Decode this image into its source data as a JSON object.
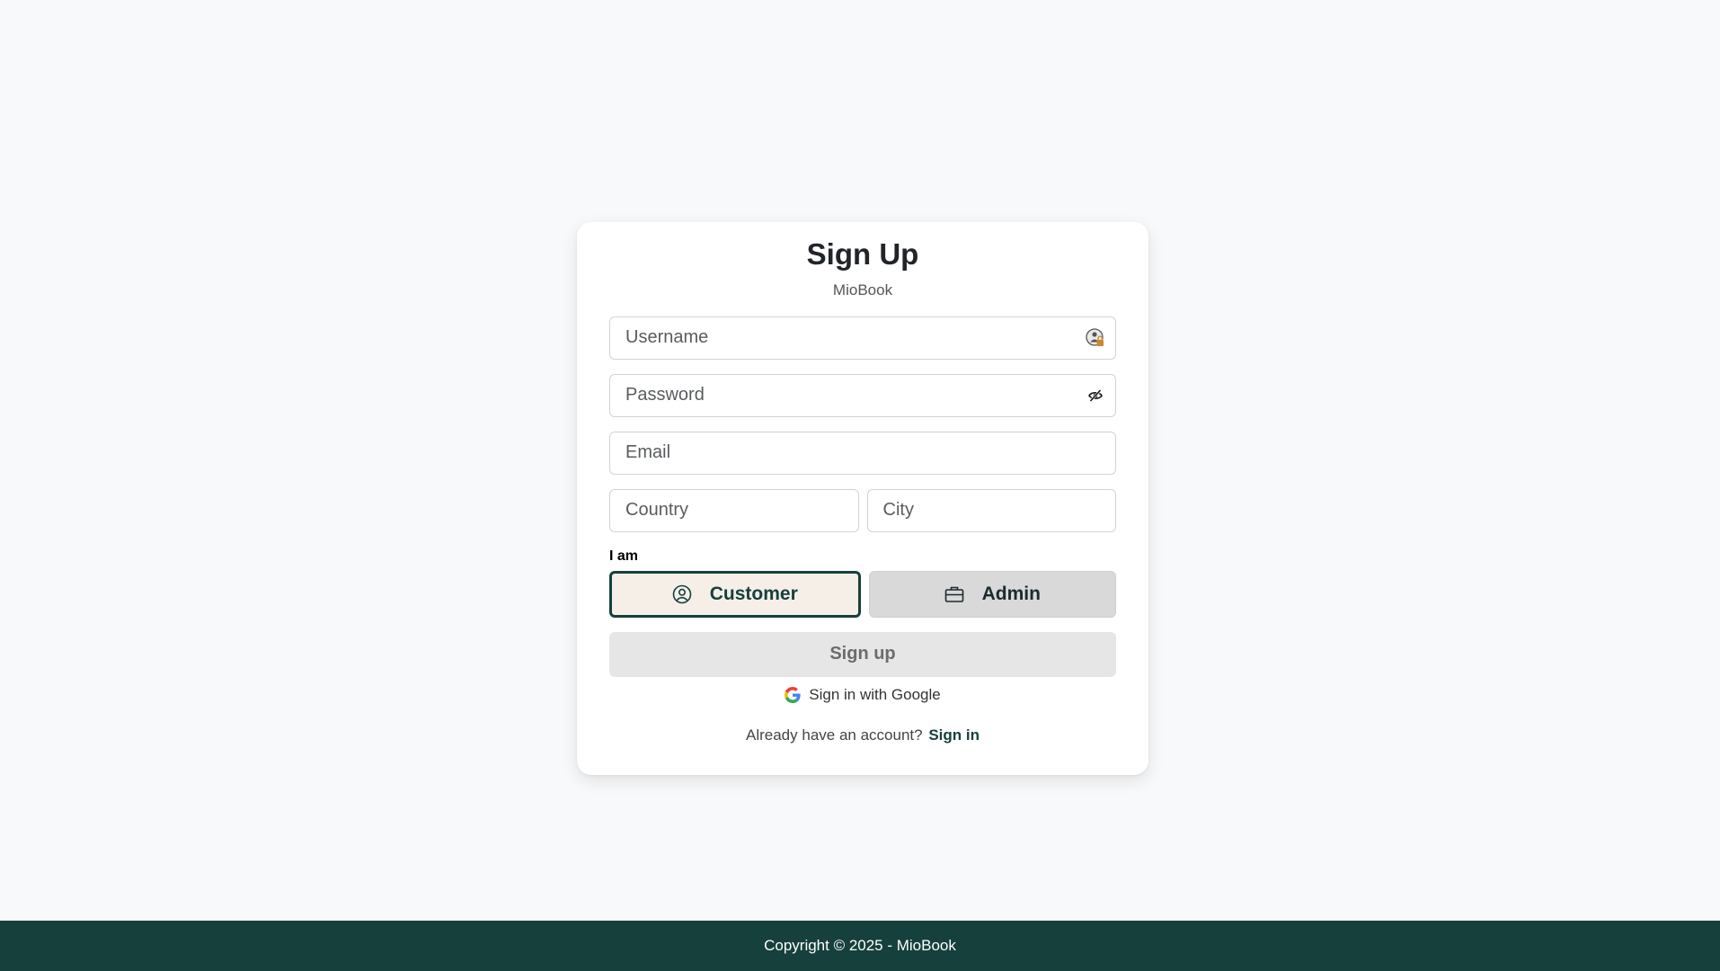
{
  "header": {
    "title": "Sign Up",
    "subtitle": "MioBook"
  },
  "form": {
    "username": {
      "placeholder": "Username",
      "value": "",
      "suffix_icon": "password-manager-icon"
    },
    "password": {
      "placeholder": "Password",
      "value": "",
      "suffix_icon": "eye-slash-icon"
    },
    "email": {
      "placeholder": "Email",
      "value": ""
    },
    "country": {
      "placeholder": "Country",
      "value": ""
    },
    "city": {
      "placeholder": "City",
      "value": ""
    }
  },
  "role": {
    "label": "I am",
    "selected": "Customer",
    "options": [
      {
        "label": "Customer",
        "icon": "user-circle-icon"
      },
      {
        "label": "Admin",
        "icon": "briefcase-icon"
      }
    ]
  },
  "actions": {
    "submit_label": "Sign up",
    "google_label": "Sign in with Google",
    "google_icon": "google-icon",
    "signin_prompt": "Already have an account?",
    "signin_link": "Sign in"
  },
  "footer": {
    "copyright": "Copyright © 2025 - MioBook"
  },
  "colors": {
    "page_bg": "#f8f9fa",
    "primary": "#16403c",
    "selected_role_bg": "#f5efe8",
    "unselected_role_bg": "#d9d9d9",
    "submit_disabled_bg": "#e6e6e6"
  }
}
